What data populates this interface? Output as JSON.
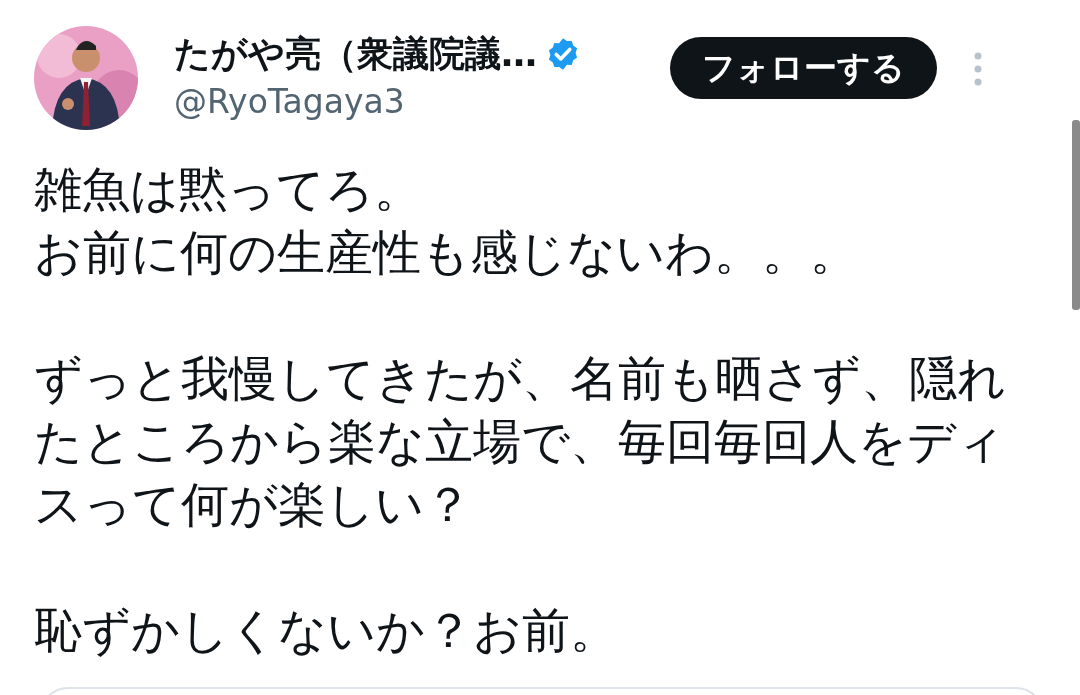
{
  "author": {
    "name": "たがや亮（衆議院議…",
    "handle": "@RyoTagaya3",
    "verified": true
  },
  "follow_button": {
    "label": "フォローする"
  },
  "tweet": {
    "paragraphs": [
      [
        "雑魚は黙ってろ。",
        "お前に何の生産性も感じないわ。。。"
      ],
      [
        "ずっと我慢してきたが、名前も晒さず、隠れ",
        "たところから楽な立場で、毎回毎回人をディ",
        "スって何が楽しい？"
      ],
      [
        "恥ずかしくないか？お前。"
      ]
    ]
  }
}
